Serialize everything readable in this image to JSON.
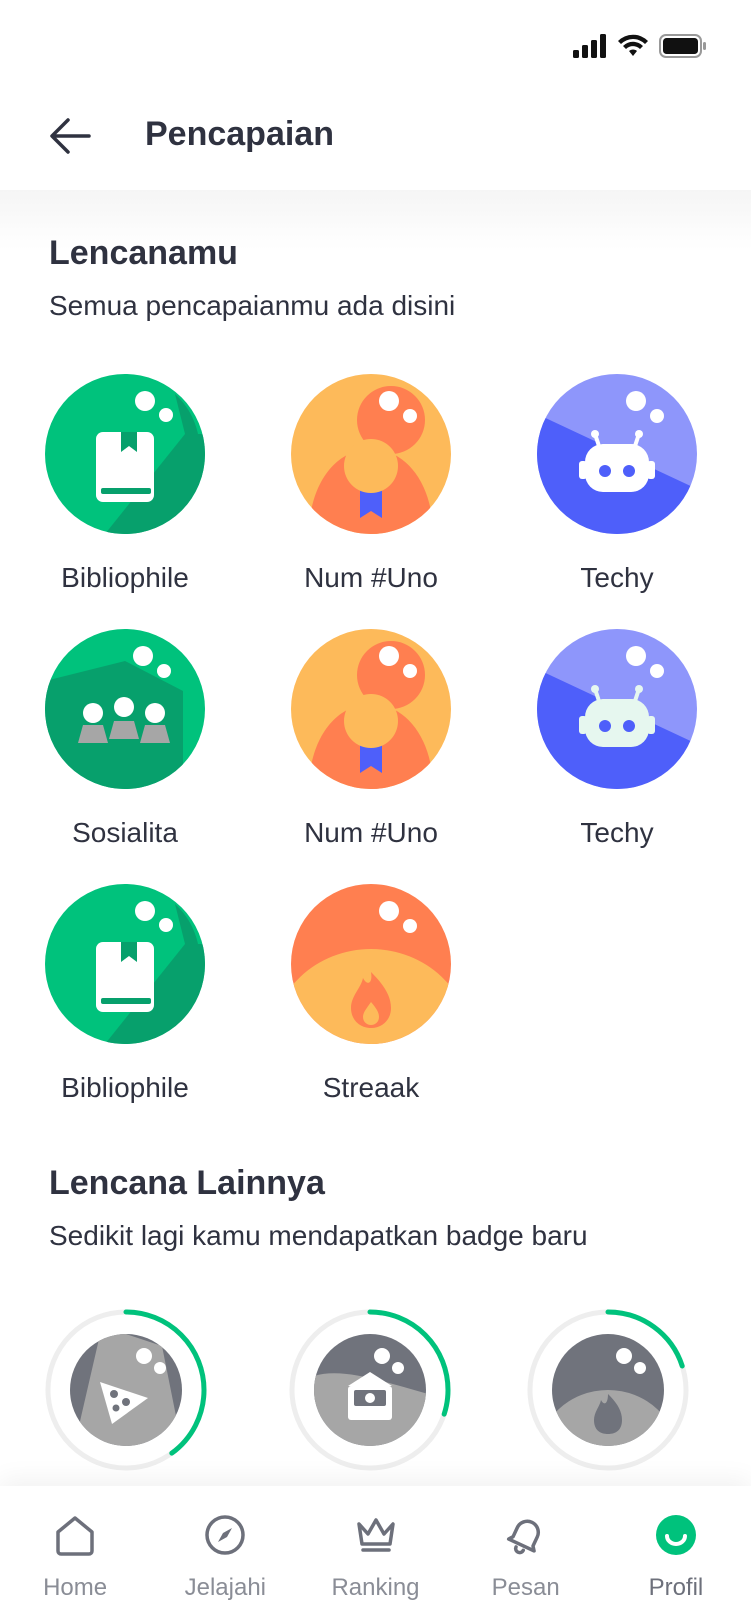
{
  "header": {
    "title": "Pencapaian"
  },
  "earned": {
    "title": "Lencanamu",
    "subtitle": "Semua pencapaianmu ada disini",
    "badges": [
      {
        "label": "Bibliophile",
        "icon": "book-icon"
      },
      {
        "label": "Num #Uno",
        "icon": "medal-icon"
      },
      {
        "label": "Techy",
        "icon": "robot-icon"
      },
      {
        "label": "Sosialita",
        "icon": "people-icon"
      },
      {
        "label": "Num #Uno",
        "icon": "medal-icon"
      },
      {
        "label": "Techy",
        "icon": "robot-icon"
      },
      {
        "label": "Bibliophile",
        "icon": "book-icon"
      },
      {
        "label": "Streaak",
        "icon": "flame-icon"
      }
    ]
  },
  "other": {
    "title": "Lencana Lainnya",
    "subtitle": "Sedikit lagi kamu mendapatkan badge baru",
    "badges": [
      {
        "icon": "pizza-icon",
        "progress": 0.4
      },
      {
        "icon": "envelope-money-icon",
        "progress": 0.3
      },
      {
        "icon": "flame-icon",
        "progress": 0.2
      }
    ]
  },
  "nav": {
    "items": [
      {
        "label": "Home",
        "icon": "home-icon"
      },
      {
        "label": "Jelajahi",
        "icon": "compass-icon"
      },
      {
        "label": "Ranking",
        "icon": "crown-icon"
      },
      {
        "label": "Pesan",
        "icon": "bell-icon"
      },
      {
        "label": "Profil",
        "icon": "profile-icon",
        "active": true
      }
    ]
  },
  "colors": {
    "green": "#00c27c",
    "green_dark": "#07a06c",
    "orange": "#ff7f50",
    "yellow": "#fdba5a",
    "indigo": "#4e5ffa",
    "indigo_light": "#8e96fb",
    "grey_dark": "#70737c",
    "grey_light": "#a6a6a6",
    "text": "#2f3240"
  }
}
